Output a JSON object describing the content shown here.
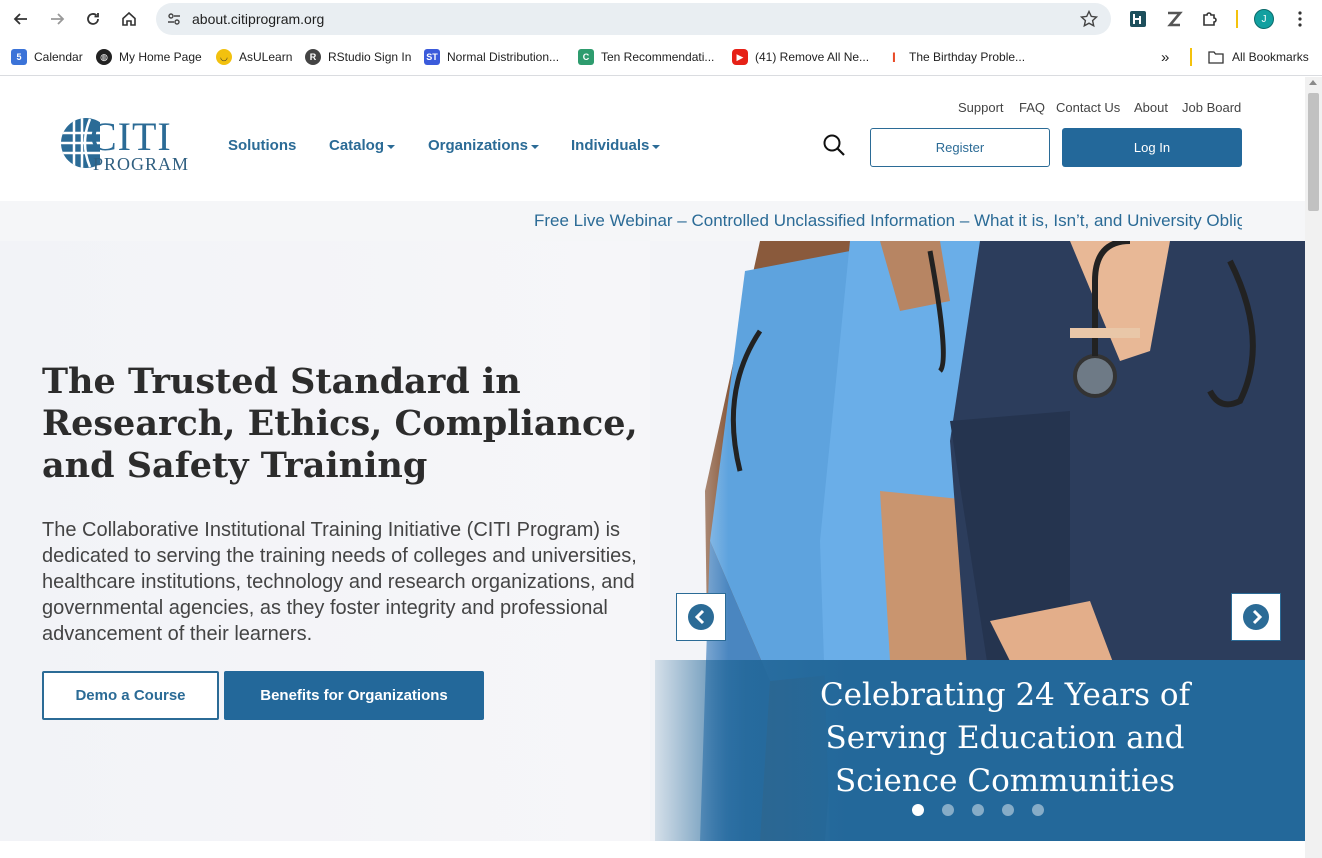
{
  "browser": {
    "url": "about.citiprogram.org",
    "profile_initial": "J",
    "bookmarks": [
      {
        "label": "Calendar"
      },
      {
        "label": "My Home Page"
      },
      {
        "label": "AsULearn"
      },
      {
        "label": "RStudio Sign In"
      },
      {
        "label": "Normal Distribution..."
      },
      {
        "label": "Ten Recommendati..."
      },
      {
        "label": "(41) Remove All Ne..."
      },
      {
        "label": "The Birthday Proble..."
      }
    ],
    "all_bookmarks": "All Bookmarks",
    "overflow": "»"
  },
  "site": {
    "logo_top": "CITI",
    "logo_bottom": "PROGRAM",
    "nav": [
      {
        "label": "Solutions"
      },
      {
        "label": "Catalog"
      },
      {
        "label": "Organizations"
      },
      {
        "label": "Individuals"
      }
    ],
    "util_nav": [
      {
        "label": "Support"
      },
      {
        "label": "FAQ"
      },
      {
        "label": "Contact Us"
      },
      {
        "label": "About"
      },
      {
        "label": "Job Board"
      }
    ],
    "register": "Register",
    "login": "Log In",
    "ticker": "Free Live Webinar – Controlled Unclassified Information – What it is, Isn’t, and University Obligat"
  },
  "hero": {
    "title": "The Trusted Standard in Research, Ethics, Compliance, and Safety Training",
    "description": "The Collaborative Institutional Training Initiative (CITI Program) is dedicated to serving the training needs of colleges and universities, healthcare institutions, technology and research organizations, and governmental agencies, as they foster integrity and professional advancement of their learners.",
    "demo_button": "Demo a Course",
    "benefits_button": "Benefits for Organizations",
    "caption": "Celebrating 24 Years of Serving Education and Science Communities",
    "slides_total": 5,
    "active_slide": 1
  },
  "colors": {
    "brand": "#23689a",
    "accent_text": "#2b6b96"
  }
}
